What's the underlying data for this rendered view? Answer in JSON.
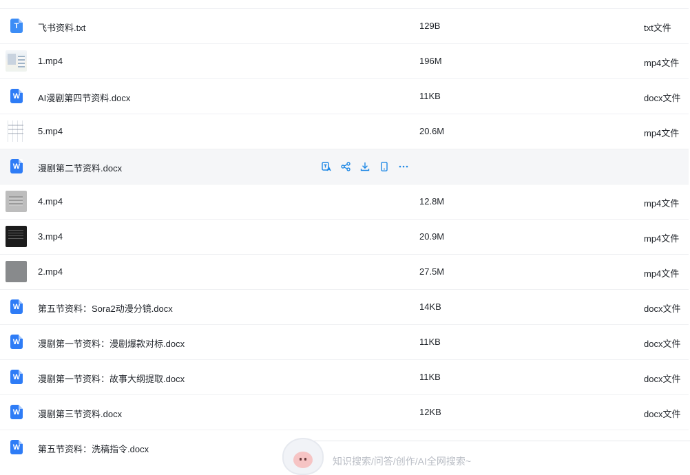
{
  "colors": {
    "accent": "#2e7cf6",
    "action_icon": "#1e88e5",
    "hover_row": "#f5f6f8"
  },
  "files": [
    {
      "name": "飞书资料.txt",
      "size": "129B",
      "type": "txt文件",
      "icon": "txt-icon"
    },
    {
      "name": "1.mp4",
      "size": "196M",
      "type": "mp4文件",
      "icon": "video-thumbnail"
    },
    {
      "name": "AI漫剧第四节资料.docx",
      "size": "11KB",
      "type": "docx文件",
      "icon": "word-icon"
    },
    {
      "name": "5.mp4",
      "size": "20.6M",
      "type": "mp4文件",
      "icon": "video-thumbnail"
    },
    {
      "name": "漫剧第二节资料.docx",
      "size": "",
      "type": "",
      "icon": "word-icon"
    },
    {
      "name": "4.mp4",
      "size": "12.8M",
      "type": "mp4文件",
      "icon": "video-thumbnail"
    },
    {
      "name": "3.mp4",
      "size": "20.9M",
      "type": "mp4文件",
      "icon": "video-thumbnail"
    },
    {
      "name": "2.mp4",
      "size": "27.5M",
      "type": "mp4文件",
      "icon": "video-thumbnail"
    },
    {
      "name": "第五节资料：Sora2动漫分镜.docx",
      "size": "14KB",
      "type": "docx文件",
      "icon": "word-icon"
    },
    {
      "name": "漫剧第一节资料：漫剧爆款对标.docx",
      "size": "11KB",
      "type": "docx文件",
      "icon": "word-icon"
    },
    {
      "name": "漫剧第一节资料：故事大纲提取.docx",
      "size": "11KB",
      "type": "docx文件",
      "icon": "word-icon"
    },
    {
      "name": "漫剧第三节资料.docx",
      "size": "12KB",
      "type": "docx文件",
      "icon": "word-icon"
    },
    {
      "name": "第五节资料：洗稿指令.docx",
      "size": "",
      "type": "",
      "icon": "word-icon"
    }
  ],
  "row_actions": [
    "translate-icon",
    "share-icon",
    "download-icon",
    "phone-icon",
    "more-icon"
  ],
  "assistant": {
    "placeholder": "知识搜索/问答/创作/AI全网搜索~"
  }
}
